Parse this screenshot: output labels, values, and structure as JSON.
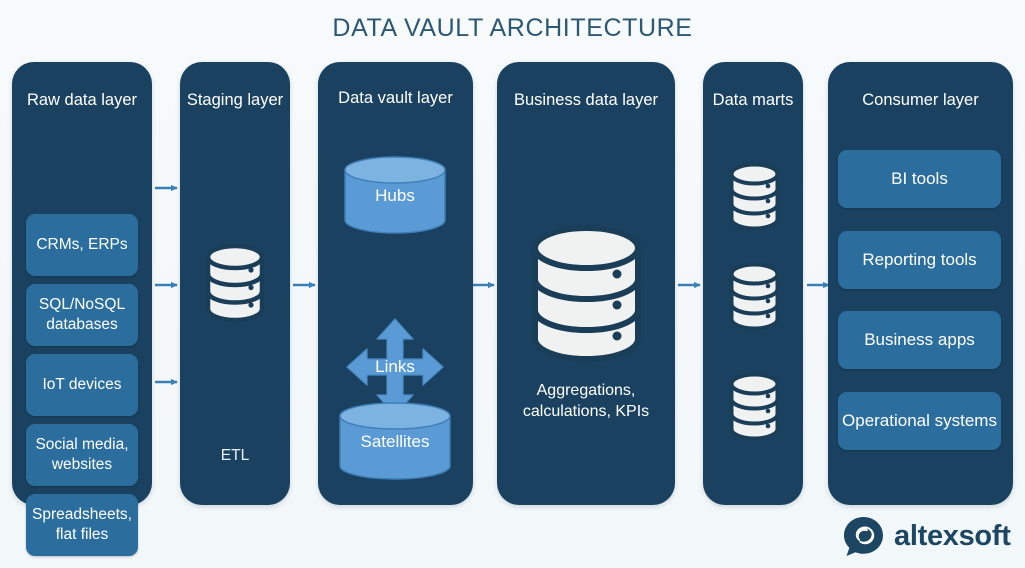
{
  "title": "DATA VAULT ARCHITECTURE",
  "colors": {
    "background": "#f7fafb",
    "panel": "#1a4260",
    "chip": "#2b6e9e",
    "accent_light_blue": "#5b9bd5",
    "arrow": "#3a7fb5",
    "db_white": "#f0f2f2",
    "title_text": "#2d5874",
    "logo": "#1d4662"
  },
  "panels": [
    {
      "id": "raw-data-layer",
      "title": "Raw data layer",
      "items": [
        {
          "label": "CRMs, ERPs"
        },
        {
          "label": "SQL/NoSQL databases"
        },
        {
          "label": "IoT devices"
        },
        {
          "label": "Social media, websites"
        },
        {
          "label": "Spreadsheets, flat files"
        }
      ]
    },
    {
      "id": "staging-layer",
      "title": "Staging layer",
      "icon": "database-cylinder-3tier",
      "footer": "ETL"
    },
    {
      "id": "data-vault-layer",
      "title": "Data vault layer",
      "items": [
        {
          "label": "Hubs",
          "icon": "cylinder-icon"
        },
        {
          "label": "Links",
          "icon": "four-way-arrow-icon"
        },
        {
          "label": "Satellites",
          "icon": "cylinder-icon"
        }
      ]
    },
    {
      "id": "business-data-layer",
      "title": "Business data layer",
      "icon": "database-cylinder-3tier",
      "caption": "Aggregations, calculations, KPIs"
    },
    {
      "id": "data-marts",
      "title": "Data marts",
      "icons": [
        "database-cylinder-3tier",
        "database-cylinder-3tier",
        "database-cylinder-3tier"
      ]
    },
    {
      "id": "consumer-layer",
      "title": "Consumer layer",
      "items": [
        {
          "label": "BI tools"
        },
        {
          "label": "Reporting tools"
        },
        {
          "label": "Business apps"
        },
        {
          "label": "Operational systems"
        }
      ]
    }
  ],
  "logo": {
    "mark": "altexsoft-bubble-icon",
    "text": "altexsoft"
  }
}
